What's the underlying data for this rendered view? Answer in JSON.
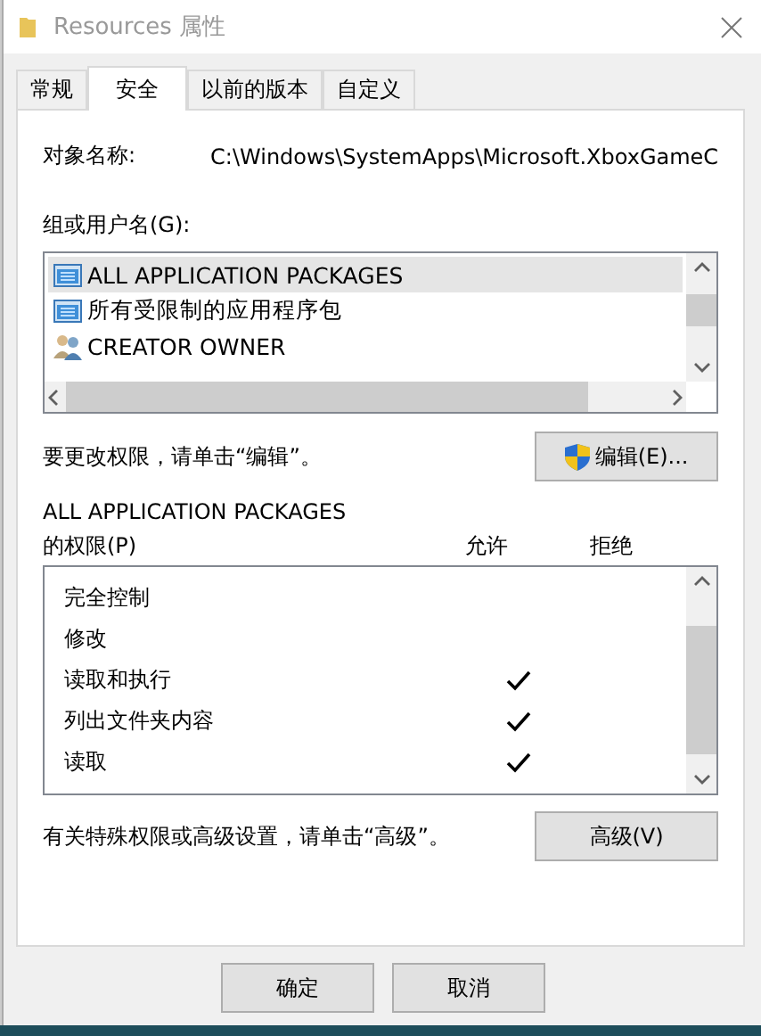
{
  "window": {
    "title": "Resources 属性"
  },
  "tabs": [
    {
      "label": "常规",
      "selected": false
    },
    {
      "label": "安全",
      "selected": true
    },
    {
      "label": "以前的版本",
      "selected": false
    },
    {
      "label": "自定义",
      "selected": false
    }
  ],
  "object_name": {
    "label": "对象名称:",
    "value": "C:\\Windows\\SystemApps\\Microsoft.XboxGameC"
  },
  "groups": {
    "label": "组或用户名(G):",
    "items": [
      {
        "name": "ALL APPLICATION PACKAGES",
        "kind": "package",
        "selected": true
      },
      {
        "name": "所有受限制的应用程序包",
        "kind": "package",
        "selected": false
      },
      {
        "name": "CREATOR OWNER",
        "kind": "group",
        "selected": false
      }
    ]
  },
  "change_hint": "要更改权限，请单击“编辑”。",
  "edit_button": "编辑(E)...",
  "permissions": {
    "title": "ALL APPLICATION PACKAGES",
    "label": "的权限(P)",
    "allow_header": "允许",
    "deny_header": "拒绝",
    "rows": [
      {
        "name": "完全控制",
        "allow": false,
        "deny": false
      },
      {
        "name": "修改",
        "allow": false,
        "deny": false
      },
      {
        "name": "读取和执行",
        "allow": true,
        "deny": false
      },
      {
        "name": "列出文件夹内容",
        "allow": true,
        "deny": false
      },
      {
        "name": "读取",
        "allow": true,
        "deny": false
      }
    ]
  },
  "advanced_hint": "有关特殊权限或高级设置，请单击“高级”。",
  "advanced_button": "高级(V)",
  "buttons": [
    "确定",
    "取消"
  ]
}
